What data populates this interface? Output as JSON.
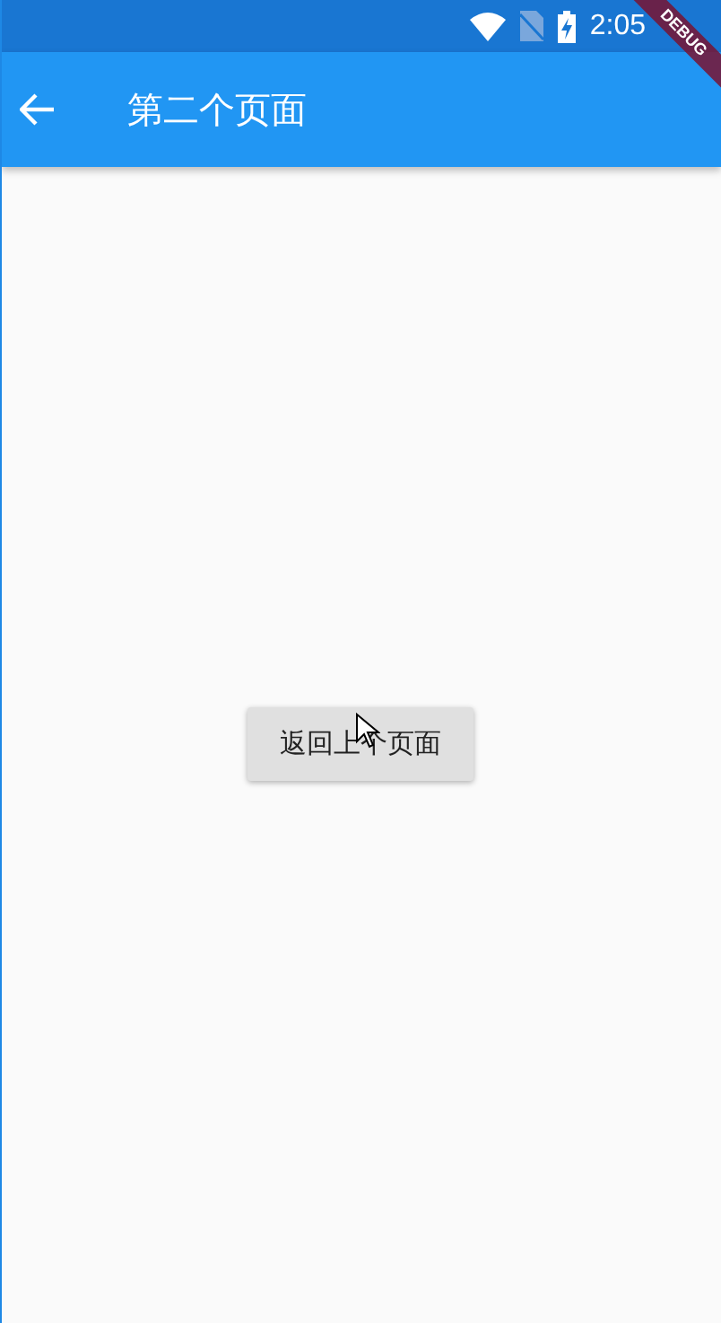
{
  "status_bar": {
    "time": "2:05"
  },
  "app_bar": {
    "title": "第二个页面"
  },
  "button": {
    "label": "返回上个页面"
  },
  "debug_banner": {
    "label": "DEBUG"
  }
}
